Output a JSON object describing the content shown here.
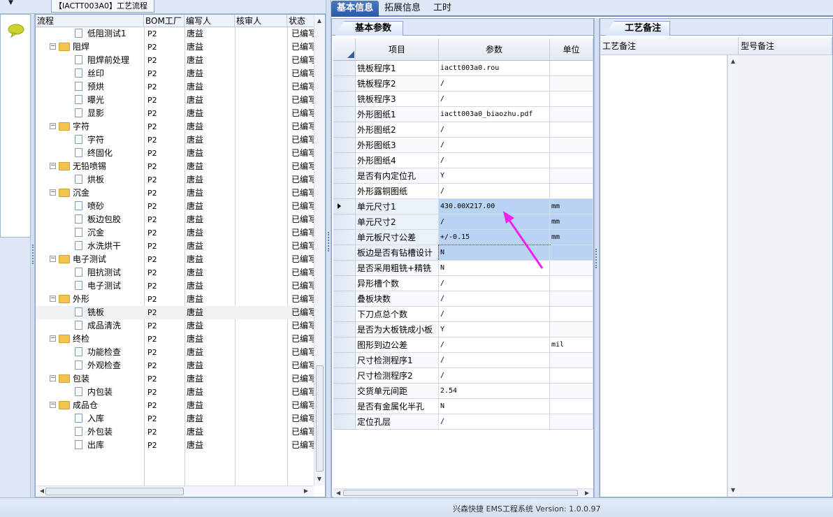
{
  "header": {
    "title_tab": "【IACTT003A0】工艺流程"
  },
  "icons": {
    "chat": "speech-bubble-icon",
    "folder": "folder-icon",
    "document": "document-icon"
  },
  "tree": {
    "columns": [
      "流程",
      "BOM工厂",
      "编写人",
      "核审人",
      "状态"
    ],
    "rows": [
      {
        "type": "doc",
        "label": "低阻测试1",
        "bom": "P2",
        "writer": "唐益",
        "status": "已编写"
      },
      {
        "type": "folder",
        "label": "阻焊",
        "bom": "P2",
        "writer": "唐益",
        "status": "已编写"
      },
      {
        "type": "doc",
        "label": "阻焊前处理",
        "bom": "P2",
        "writer": "唐益",
        "status": "已编写"
      },
      {
        "type": "doc",
        "label": "丝印",
        "bom": "P2",
        "writer": "唐益",
        "status": "已编写"
      },
      {
        "type": "doc",
        "label": "预烘",
        "bom": "P2",
        "writer": "唐益",
        "status": "已编写"
      },
      {
        "type": "doc",
        "label": "曝光",
        "bom": "P2",
        "writer": "唐益",
        "status": "已编写"
      },
      {
        "type": "doc",
        "label": "显影",
        "bom": "P2",
        "writer": "唐益",
        "status": "已编写"
      },
      {
        "type": "folder",
        "label": "字符",
        "bom": "P2",
        "writer": "唐益",
        "status": "已编写"
      },
      {
        "type": "doc",
        "label": "字符",
        "bom": "P2",
        "writer": "唐益",
        "status": "已编写"
      },
      {
        "type": "doc",
        "label": "终固化",
        "bom": "P2",
        "writer": "唐益",
        "status": "已编写"
      },
      {
        "type": "folder",
        "label": "无铅喷锡",
        "bom": "P2",
        "writer": "唐益",
        "status": "已编写"
      },
      {
        "type": "doc",
        "label": "烘板",
        "bom": "P2",
        "writer": "唐益",
        "status": "已编写"
      },
      {
        "type": "folder",
        "label": "沉金",
        "bom": "P2",
        "writer": "唐益",
        "status": "已编写"
      },
      {
        "type": "doc",
        "label": "喷砂",
        "bom": "P2",
        "writer": "唐益",
        "status": "已编写"
      },
      {
        "type": "doc",
        "label": "板边包胶",
        "bom": "P2",
        "writer": "唐益",
        "status": "已编写"
      },
      {
        "type": "doc",
        "label": "沉金",
        "bom": "P2",
        "writer": "唐益",
        "status": "已编写"
      },
      {
        "type": "doc",
        "label": "水洗烘干",
        "bom": "P2",
        "writer": "唐益",
        "status": "已编写"
      },
      {
        "type": "folder",
        "label": "电子测试",
        "bom": "P2",
        "writer": "唐益",
        "status": "已编写"
      },
      {
        "type": "doc",
        "label": "阻抗测试",
        "bom": "P2",
        "writer": "唐益",
        "status": "已编写"
      },
      {
        "type": "doc",
        "label": "电子测试",
        "bom": "P2",
        "writer": "唐益",
        "status": "已编写"
      },
      {
        "type": "folder",
        "label": "外形",
        "bom": "P2",
        "writer": "唐益",
        "status": "已编写"
      },
      {
        "type": "doc",
        "label": "铣板",
        "bom": "P2",
        "writer": "唐益",
        "status": "已编写",
        "selected": true
      },
      {
        "type": "doc",
        "label": "成品清洗",
        "bom": "P2",
        "writer": "唐益",
        "status": "已编写"
      },
      {
        "type": "folder",
        "label": "终检",
        "bom": "P2",
        "writer": "唐益",
        "status": "已编写"
      },
      {
        "type": "doc",
        "label": "功能检查",
        "bom": "P2",
        "writer": "唐益",
        "status": "已编写"
      },
      {
        "type": "doc",
        "label": "外观检查",
        "bom": "P2",
        "writer": "唐益",
        "status": "已编写"
      },
      {
        "type": "folder",
        "label": "包装",
        "bom": "P2",
        "writer": "唐益",
        "status": "已编写"
      },
      {
        "type": "doc",
        "label": "内包装",
        "bom": "P2",
        "writer": "唐益",
        "status": "已编写"
      },
      {
        "type": "folder",
        "label": "成品仓",
        "bom": "P2",
        "writer": "唐益",
        "status": "已编写"
      },
      {
        "type": "doc",
        "label": "入库",
        "bom": "P2",
        "writer": "唐益",
        "status": "已编写"
      },
      {
        "type": "doc",
        "label": "外包装",
        "bom": "P2",
        "writer": "唐益",
        "status": "已编写"
      },
      {
        "type": "doc",
        "label": "出库",
        "bom": "P2",
        "writer": "唐益",
        "status": "已编写"
      }
    ]
  },
  "tabs": [
    {
      "label": "基本信息",
      "active": true
    },
    {
      "label": "拓展信息",
      "active": false
    },
    {
      "label": "工时",
      "active": false
    }
  ],
  "params": {
    "subtab": "基本参数",
    "columns": [
      "项目",
      "参数",
      "单位"
    ],
    "rows": [
      {
        "name": "铣板程序1",
        "value": "iactt003a0.rou",
        "unit": ""
      },
      {
        "name": "铣板程序2",
        "value": "/",
        "unit": ""
      },
      {
        "name": "铣板程序3",
        "value": "/",
        "unit": ""
      },
      {
        "name": "外形图纸1",
        "value": "iactt003a0_biaozhu.pdf",
        "unit": ""
      },
      {
        "name": "外形图纸2",
        "value": "/",
        "unit": ""
      },
      {
        "name": "外形图纸3",
        "value": "/",
        "unit": ""
      },
      {
        "name": "外形图纸4",
        "value": "/",
        "unit": ""
      },
      {
        "name": "是否有内定位孔",
        "value": "Y",
        "unit": ""
      },
      {
        "name": "外形露铜图纸",
        "value": "/",
        "unit": ""
      },
      {
        "name": "单元尺寸1",
        "value": "430.00X217.00",
        "unit": "mm",
        "highlight": true,
        "current": true
      },
      {
        "name": "单元尺寸2",
        "value": "/",
        "unit": "mm",
        "highlight": true
      },
      {
        "name": "单元板尺寸公差",
        "value": "+/-0.15",
        "unit": "mm",
        "highlight": true
      },
      {
        "name": "板边是否有钻槽设计",
        "value": "N",
        "unit": "",
        "highlight": true,
        "focused": true
      },
      {
        "name": "是否采用粗铣+精铣",
        "value": "N",
        "unit": ""
      },
      {
        "name": "异形槽个数",
        "value": "/",
        "unit": ""
      },
      {
        "name": "叠板块数",
        "value": "/",
        "unit": ""
      },
      {
        "name": "下刀点总个数",
        "value": "/",
        "unit": ""
      },
      {
        "name": "是否为大板铣成小板",
        "value": "Y",
        "unit": ""
      },
      {
        "name": "图形到边公差",
        "value": "/",
        "unit": "mil"
      },
      {
        "name": "尺寸检测程序1",
        "value": "/",
        "unit": ""
      },
      {
        "name": "尺寸检测程序2",
        "value": "/",
        "unit": ""
      },
      {
        "name": "交货单元间距",
        "value": "2.54",
        "unit": ""
      },
      {
        "name": "是否有金属化半孔",
        "value": "N",
        "unit": ""
      },
      {
        "name": "定位孔层",
        "value": "/",
        "unit": ""
      }
    ]
  },
  "notes": {
    "tab": "工艺备注",
    "columns": [
      "工艺备注",
      "型号备注"
    ]
  },
  "annotation": {
    "color": "#ee22ee"
  },
  "status": {
    "text": "兴森快捷 EMS工程系统 Version: 1.0.0.97"
  }
}
